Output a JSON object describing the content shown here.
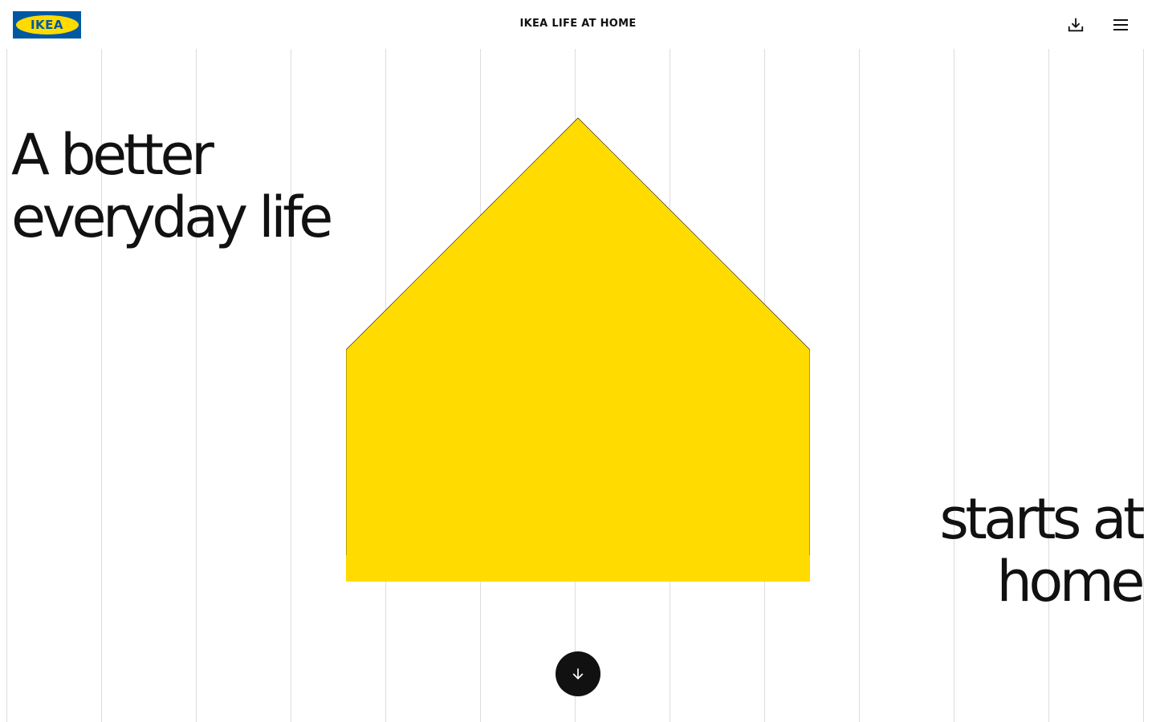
{
  "header": {
    "logo_text": "IKEA",
    "title": "IKEA LIFE AT HOME",
    "download_icon": "download-icon",
    "menu_icon": "hamburger-menu-icon"
  },
  "hero": {
    "headline_left": [
      "A better",
      "everyday life"
    ],
    "headline_right": [
      "starts at",
      "home"
    ],
    "house_color": "#ffdb00",
    "scroll_icon": "arrow-down-icon"
  },
  "colors": {
    "brand_blue": "#0058a3",
    "brand_yellow": "#ffdb00",
    "text": "#111111",
    "grid_line": "#dcdcdc"
  }
}
